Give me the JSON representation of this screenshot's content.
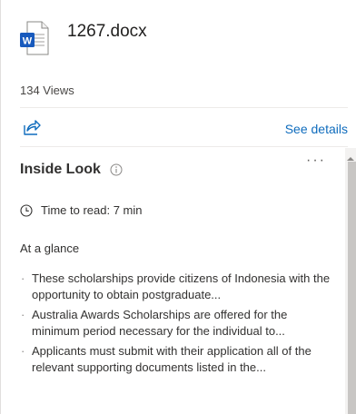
{
  "file": {
    "name": "1267.docx",
    "icon": "word-document-icon",
    "icon_letter": "W",
    "brand_color": "#185abd"
  },
  "views_label": "134 Views",
  "actions": {
    "share_icon": "share-icon",
    "see_details_label": "See details",
    "link_color": "#0f6cbd"
  },
  "inside_look": {
    "title": "Inside Look",
    "info_icon": "info-icon",
    "more_label": "···",
    "time_to_read": "Time to read: 7 min",
    "at_a_glance": "At a glance",
    "bullets": [
      "These scholarships provide citizens of Indonesia with the opportunity to obtain postgraduate...",
      "Australia Awards Scholarships are offered for the minimum period necessary for the individual to...",
      "Applicants must submit with their application all of the relevant supporting documents listed in the..."
    ]
  }
}
